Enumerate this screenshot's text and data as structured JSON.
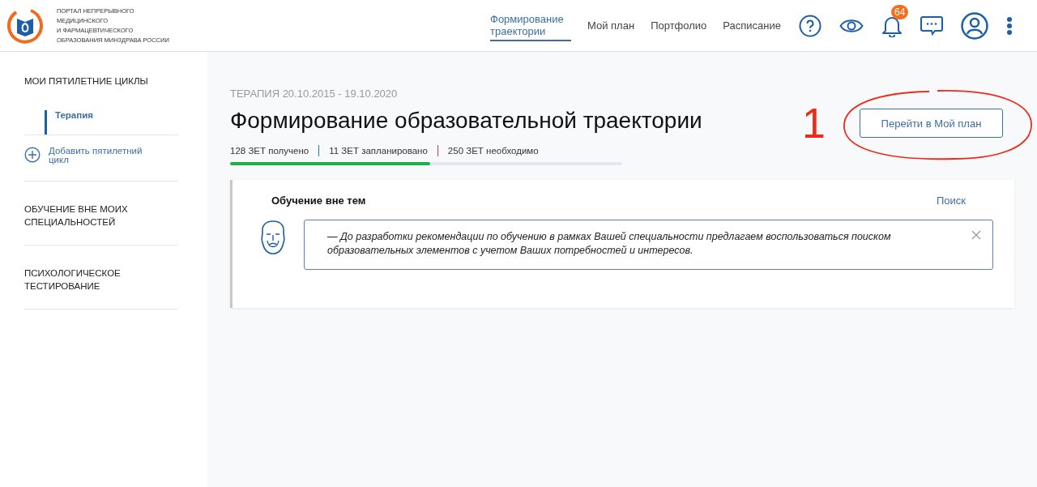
{
  "logo": {
    "lines": [
      "ПОРТАЛ НЕПРЕРЫВНОГО",
      "МЕДИЦИНСКОГО",
      "И ФАРМАЦЕВТИЧЕСКОГО",
      "ОБРАЗОВАНИЯ МИНЗДРАВА РОССИИ"
    ]
  },
  "nav": [
    {
      "label": "Формирование траектории",
      "selected": true
    },
    {
      "label": "Мой план",
      "selected": false
    },
    {
      "label": "Портфолио",
      "selected": false
    },
    {
      "label": "Расписание",
      "selected": false
    }
  ],
  "notifications": {
    "count": "64"
  },
  "sidebar": {
    "sections": [
      {
        "title": "МОИ ПЯТИЛЕТНИЕ ЦИКЛЫ",
        "items": [
          {
            "label": "Терапия",
            "selected": true
          }
        ],
        "add_link": "Добавить пятилетний цикл"
      },
      {
        "title": "ОБУЧЕНИЕ ВНЕ МОИХ СПЕЦИАЛЬНОСТЕЙ"
      },
      {
        "title": "ПСИХОЛОГИЧЕСКОЕ ТЕСТИРОВАНИЕ"
      }
    ]
  },
  "page": {
    "subtitle": "ТЕРАПИЯ 20.10.2015 - 19.10.2020",
    "title": "Формирование образовательной траектории",
    "button": "Перейти в Мой план",
    "stats": [
      "128 ЗЕТ получено",
      "11 ЗЕТ запланировано",
      "250 ЗЕТ необходимо"
    ],
    "progress": {
      "level": 0.51
    }
  },
  "annotation": {
    "label": "1"
  },
  "card": {
    "title": "Обучение вне тем",
    "link": "Поиск",
    "message": "— До разработки рекомендации по обучению в рамках Вашей специальности предлагаем воспользоваться поиском образовательных элементов с учетом Ваших потребностей и интересов."
  }
}
